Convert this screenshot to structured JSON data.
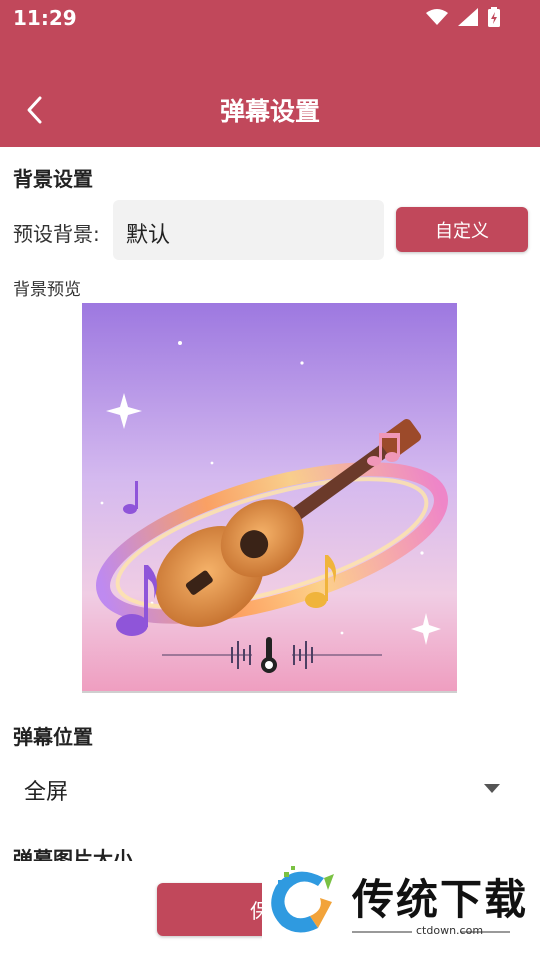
{
  "status_bar": {
    "time": "11:29"
  },
  "header": {
    "title": "弹幕设置"
  },
  "background_section": {
    "title": "背景设置",
    "preset_label": "预设背景:",
    "preset_value": "默认",
    "custom_button": "自定义",
    "preview_label": "背景预览"
  },
  "danmaku_position": {
    "title": "弹幕位置",
    "selected": "全屏"
  },
  "danmaku_size": {
    "title": "弹幕图片大小"
  },
  "footer": {
    "save_button": "保存"
  },
  "watermark": {
    "brand": "传统下载",
    "domain": "ctdown.com"
  },
  "colors": {
    "accent": "#c1485b"
  }
}
